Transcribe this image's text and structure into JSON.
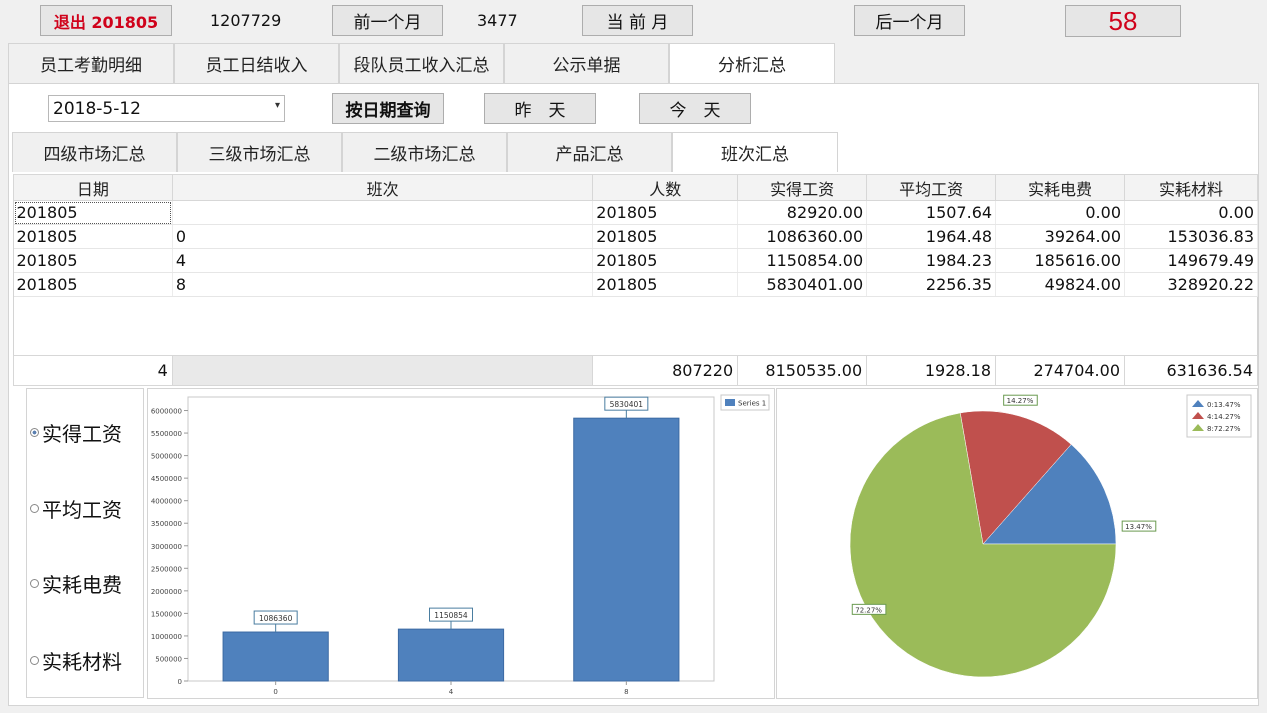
{
  "topbar": {
    "exit_label": "退出 201805",
    "code": "1207729",
    "prev_month": "前一个月",
    "count": "3477",
    "this_month": "当 前 月",
    "next_month": "后一个月",
    "badge": "58"
  },
  "main_tabs": [
    "员工考勤明细",
    "员工日结收入",
    "段队员工收入汇总",
    "公示单据",
    "分析汇总"
  ],
  "query": {
    "date_value": "2018-5-12",
    "query_button": "按日期查询",
    "yesterday_button": "昨　天",
    "today_button": "今　天"
  },
  "sub_tabs": [
    "四级市场汇总",
    "三级市场汇总",
    "二级市场汇总",
    "产品汇总",
    "班次汇总"
  ],
  "table": {
    "headers": [
      "日期",
      "班次",
      "人数",
      "实得工资",
      "平均工资",
      "实耗电费",
      "实耗材料"
    ],
    "rows": [
      [
        "201805",
        "",
        "201805",
        "82920.00",
        "1507.64",
        "0.00",
        "0.00"
      ],
      [
        "201805",
        "0",
        "201805",
        "1086360.00",
        "1964.48",
        "39264.00",
        "153036.83"
      ],
      [
        "201805",
        "4",
        "201805",
        "1150854.00",
        "1984.23",
        "185616.00",
        "149679.49"
      ],
      [
        "201805",
        "8",
        "201805",
        "5830401.00",
        "2256.35",
        "49824.00",
        "328920.22"
      ]
    ],
    "footer": [
      "4",
      "",
      "807220",
      "8150535.00",
      "1928.18",
      "274704.00",
      "631636.54"
    ]
  },
  "radio_options": [
    "实得工资",
    "平均工资",
    "实耗电费",
    "实耗材料"
  ],
  "colors": {
    "bar": "#4f81bd",
    "pie_blue": "#4f81bd",
    "pie_red": "#c0504d",
    "pie_green": "#9bbb59",
    "exit_red": "#d0021b"
  },
  "chart_data": [
    {
      "type": "bar",
      "categories": [
        "0",
        "4",
        "8"
      ],
      "series": [
        {
          "name": "Series 1",
          "values": [
            1086360,
            1150854,
            5830401
          ]
        }
      ],
      "data_labels": [
        "1086360",
        "1150854",
        "5830401"
      ],
      "yticks": [
        "0",
        "500000",
        "1000000",
        "1500000",
        "2000000",
        "2500000",
        "3000000",
        "3500000",
        "4000000",
        "4500000",
        "5000000",
        "5500000",
        "6000000"
      ],
      "ylim": [
        0,
        6300000
      ],
      "grid": false,
      "legend_position": "top-right"
    },
    {
      "type": "pie",
      "labels": [
        "0:13.47%",
        "4:14.27%",
        "8:72.27%"
      ],
      "values": [
        13.47,
        14.27,
        72.27
      ],
      "data_labels": [
        "13.47%",
        "14.27%",
        "72.27%"
      ],
      "legend_position": "top-right"
    }
  ]
}
